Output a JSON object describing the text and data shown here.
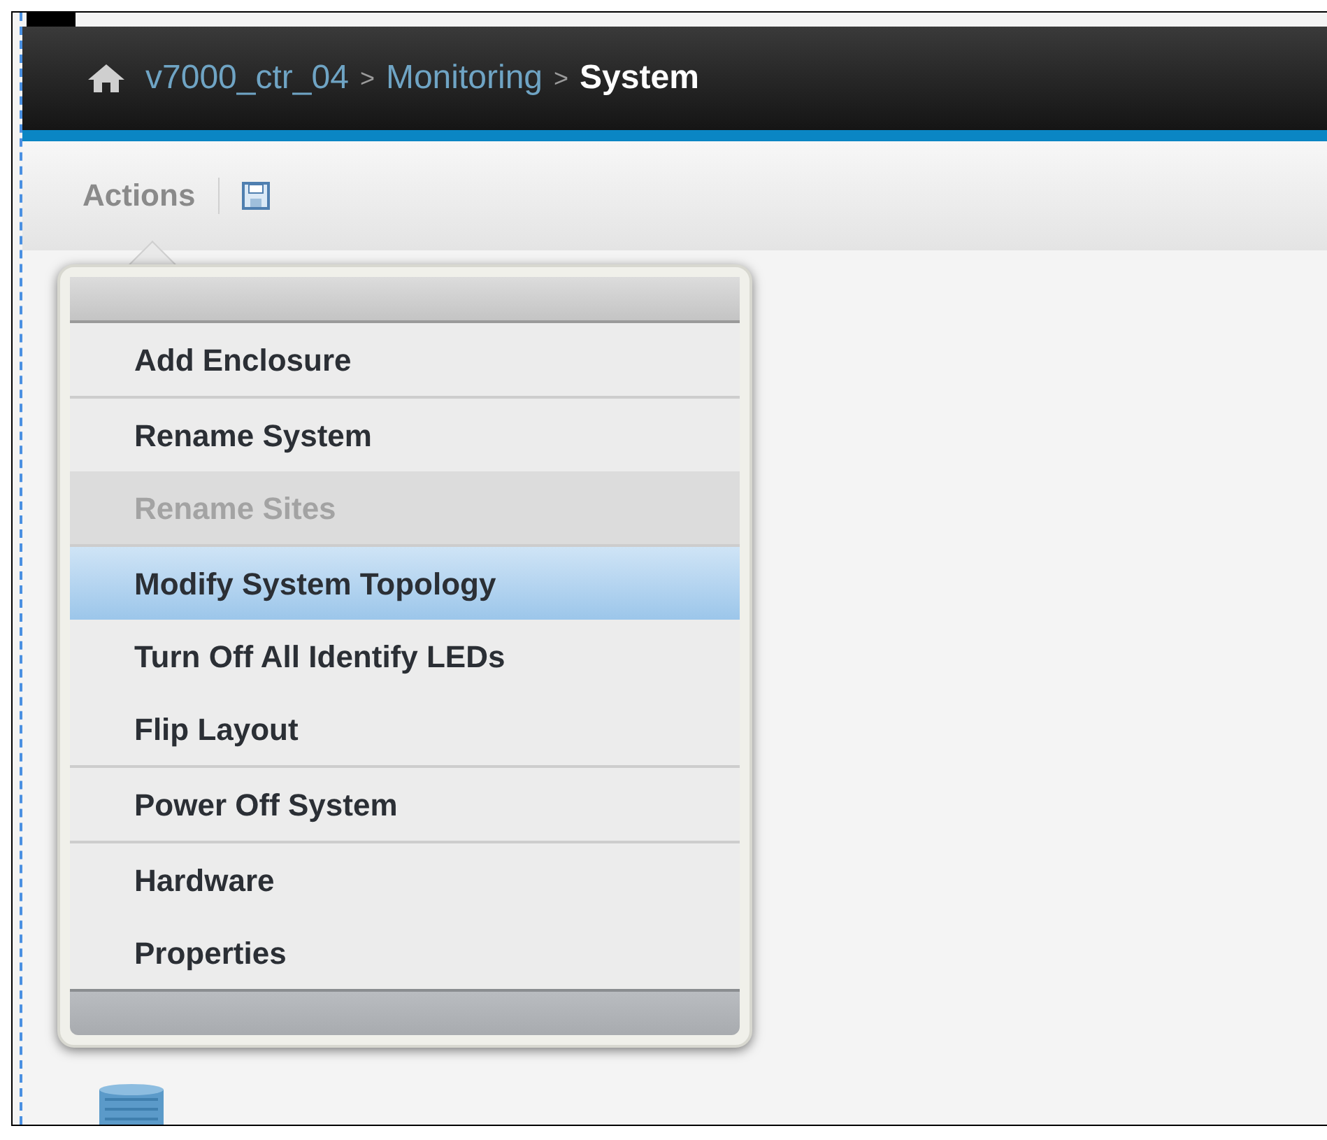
{
  "breadcrumb": [
    {
      "label": "v7000_ctr_04",
      "current": false
    },
    {
      "label": "Monitoring",
      "current": false
    },
    {
      "label": "System",
      "current": true
    }
  ],
  "breadcrumb_separator": ">",
  "toolbar": {
    "actions_label": "Actions"
  },
  "actions_menu": {
    "groups": [
      [
        {
          "label": "Add Enclosure",
          "disabled": false,
          "selected": false
        }
      ],
      [
        {
          "label": "Rename System",
          "disabled": false,
          "selected": false
        },
        {
          "label": "Rename Sites",
          "disabled": true,
          "selected": false
        }
      ],
      [
        {
          "label": "Modify System Topology",
          "disabled": false,
          "selected": true
        },
        {
          "label": "Turn Off All Identify LEDs",
          "disabled": false,
          "selected": false
        },
        {
          "label": "Flip Layout",
          "disabled": false,
          "selected": false
        }
      ],
      [
        {
          "label": "Power Off System",
          "disabled": false,
          "selected": false
        }
      ],
      [
        {
          "label": "Hardware",
          "disabled": false,
          "selected": false
        },
        {
          "label": "Properties",
          "disabled": false,
          "selected": false
        }
      ]
    ]
  }
}
